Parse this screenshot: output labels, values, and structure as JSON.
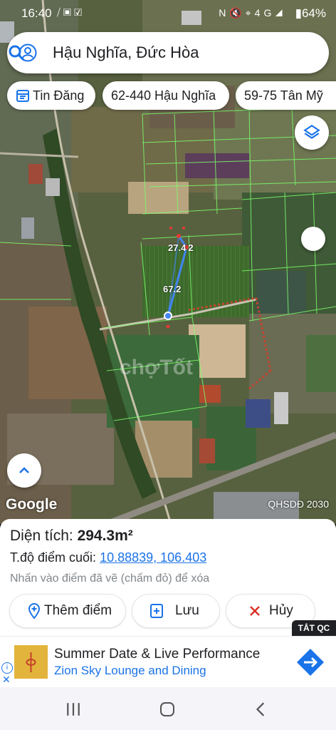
{
  "status_bar": {
    "time": "16:40",
    "battery": "64%",
    "icons": [
      "signal-slash-icon",
      "image-icon",
      "check-box-icon",
      "nfc-icon",
      "mute-icon",
      "location-icon",
      "4g-icon",
      "signal-icon",
      "battery-icon"
    ],
    "network": "4G"
  },
  "search": {
    "query": "Hậu Nghĩa, Đức Hòa"
  },
  "chips": [
    {
      "label": "Tin Đăng",
      "icon": "calendar-icon"
    },
    {
      "label": "62-440 Hậu Nghĩa"
    },
    {
      "label": "59-75 Tân Mỹ"
    }
  ],
  "map": {
    "measure_labels": {
      "segment_top": "27.4",
      "segment_top_suffix": "2",
      "segment_long": "67.2"
    },
    "watermark": "chợTốt",
    "logo": "Google",
    "copyright": "QHSDĐ 2030",
    "colors": {
      "route": "#4285f4",
      "boundary": "#7cff6a",
      "red_point": "#e53935"
    }
  },
  "info": {
    "area_label": "Diện tích:",
    "area_value": "294.3m²",
    "coord_label": "T.độ điểm cuối:",
    "coord_value": "10.88839, 106.403",
    "hint": "Nhấn vào điểm đã vẽ (chấm đỏ) để xóa"
  },
  "actions": {
    "add_point": "Thêm điểm",
    "save": "Lưu",
    "cancel": "Hủy"
  },
  "ad": {
    "tag": "TẮT QC",
    "title": "Summer Date & Live Performance",
    "subtitle": "Zion Sky Lounge and Dining",
    "colors": {
      "brand": "#1a73e8"
    }
  }
}
